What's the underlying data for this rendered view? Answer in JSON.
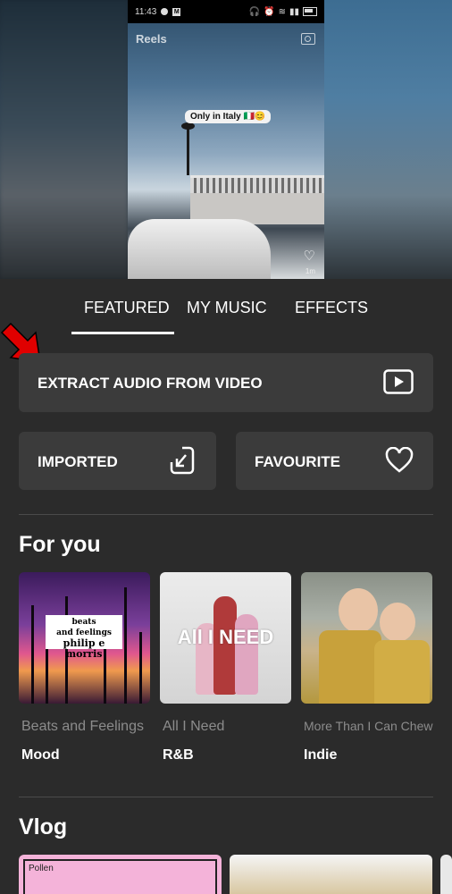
{
  "preview": {
    "status_time": "11:43",
    "reels_label": "Reels",
    "sticker_text": "Only in Italy 🇮🇹😊",
    "time_ago": "1m"
  },
  "tabs": [
    {
      "label": "FEATURED",
      "active": true
    },
    {
      "label": "MY MUSIC",
      "active": false
    },
    {
      "label": "EFFECTS",
      "active": false
    }
  ],
  "extract": {
    "label": "EXTRACT AUDIO FROM VIDEO",
    "icon": "play-icon"
  },
  "imported": {
    "label": "IMPORTED",
    "icon": "import-icon"
  },
  "favourite": {
    "label": "FAVOURITE",
    "icon": "heart-icon"
  },
  "for_you": {
    "title": "For you",
    "items": [
      {
        "song": "Beats and Feelings",
        "genre": "Mood",
        "cover_line1": "beats",
        "cover_line2": "and feelings",
        "cover_line3": "philip e morris"
      },
      {
        "song": "All I Need",
        "genre": "R&B",
        "cover_text": "All I NEED"
      },
      {
        "song": "More Than I Can Chew",
        "genre": "Indie"
      }
    ]
  },
  "vlog": {
    "title": "Vlog",
    "first_cover_label": "Pollen"
  },
  "colors": {
    "background": "#2b2b2b",
    "card": "#3b3b3b",
    "arrow": "#e00000"
  }
}
